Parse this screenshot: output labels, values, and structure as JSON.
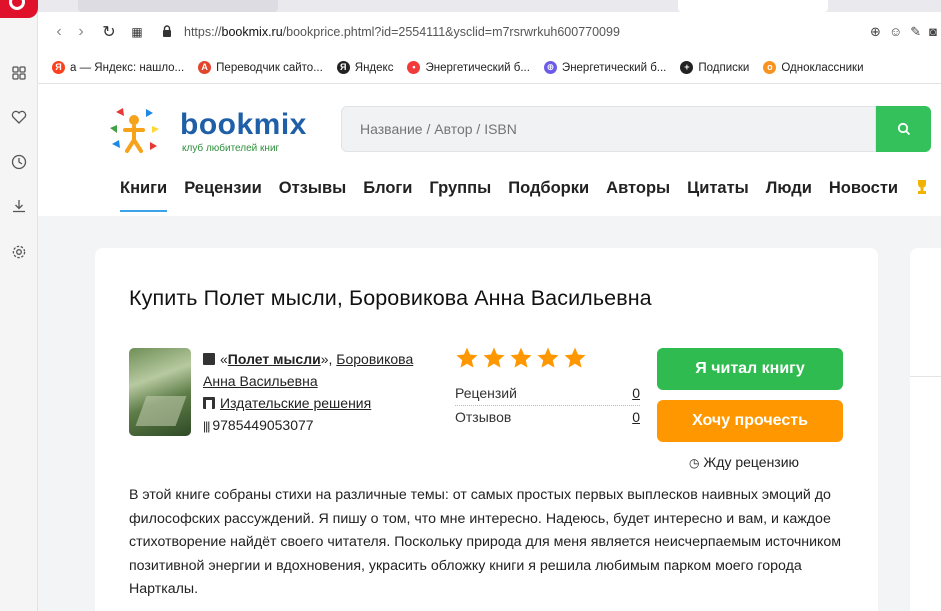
{
  "browser": {
    "url_prefix": "https://",
    "url_domain": "bookmix.ru",
    "url_path": "/bookprice.phtml?id=2554111&ysclid=m7rsrwrkuh600770099",
    "bookmarks": [
      {
        "label": "a — Яндекс: нашло...",
        "icon": "yandex-icon",
        "color": "#fc3f1d",
        "glyph": "Я"
      },
      {
        "label": "Переводчик сайто...",
        "icon": "translator-icon",
        "color": "#e2452b",
        "glyph": "A"
      },
      {
        "label": "Яндекс",
        "icon": "yandex-icon",
        "color": "#222222",
        "glyph": "Я"
      },
      {
        "label": "Энергетический б...",
        "icon": "map-pin-icon",
        "color": "#f23a3a",
        "glyph": "•"
      },
      {
        "label": "Энергетический б...",
        "icon": "globe-icon",
        "color": "#6d5ce8",
        "glyph": "⊕"
      },
      {
        "label": "Подписки",
        "icon": "plus-icon",
        "color": "#222222",
        "glyph": "+"
      },
      {
        "label": "Одноклассники",
        "icon": "ok-icon",
        "color": "#f7931e",
        "glyph": "о"
      }
    ]
  },
  "site": {
    "logo_word": "bookmix",
    "logo_tagline": "клуб любителей книг",
    "search_placeholder": "Название / Автор / ISBN",
    "menu": [
      "Книги",
      "Рецензии",
      "Отзывы",
      "Блоги",
      "Группы",
      "Подборки",
      "Авторы",
      "Цитаты",
      "Люди",
      "Новости"
    ]
  },
  "book": {
    "page_title": "Купить Полет мысли, Боровикова Анна Васильевна",
    "quote_open": "«",
    "title": "Полет мысли",
    "quote_close": "», ",
    "author": "Боровикова Анна Васильевна",
    "publisher": "Издательские решения",
    "isbn": "9785449053077",
    "rating": 5,
    "reviews_label": "Рецензий",
    "reviews_count": "0",
    "feedback_label": "Отзывов",
    "feedback_count": "0",
    "btn_read": "Я читал книгу",
    "btn_want": "Хочу прочесть",
    "wait_review": "Жду рецензию",
    "description": "В этой книге собраны стихи на различные темы: от самых простых первых выплесков наивных эмоций до философских рассуждений. Я пишу о том, что мне интересно. Надеюсь, будет интересно и вам, и каждое стихотворение найдёт своего читателя. Поскольку природа для меня является неисчерпаемым источником позитивной энергии и вдохновения, украсить обложку книги я решила любимым парком моего города Нарткалы."
  },
  "colors": {
    "accent_green": "#2fbb4f",
    "accent_orange": "#ff9800",
    "star": "#ff9800",
    "logo_blue": "#1f5fa8"
  }
}
